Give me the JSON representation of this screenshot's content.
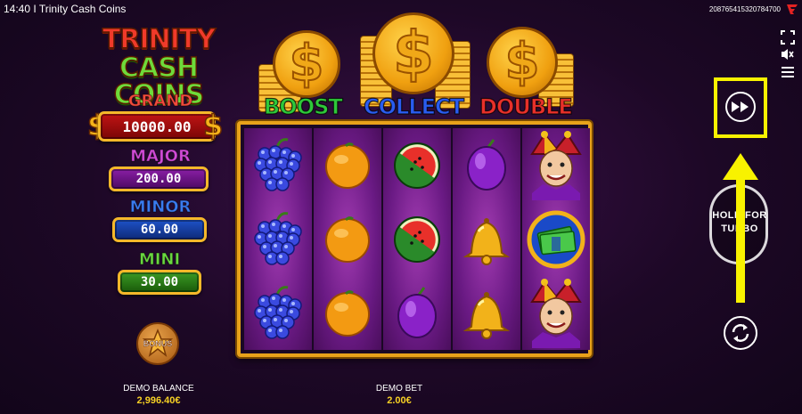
{
  "top_bar": {
    "time": "14:40",
    "separator": "I",
    "game_title": "Trinity Cash Coins",
    "session_id": "208765415320784700"
  },
  "logo": {
    "line1": "TRINITY",
    "line2": "CASH COINS"
  },
  "jackpots": {
    "grand": {
      "label": "GRAND",
      "value": "10000.00",
      "color": "#c01414"
    },
    "major": {
      "label": "MAJOR",
      "value": "200.00",
      "color": "#8a1ea6"
    },
    "minor": {
      "label": "MINOR",
      "value": "60.00",
      "color": "#1e52c8"
    },
    "mini": {
      "label": "MINI",
      "value": "30.00",
      "color": "#3a9a24"
    }
  },
  "bonus": {
    "label": "BONUS"
  },
  "features": {
    "boost": {
      "label": "BOOST",
      "color": "#2ec83a"
    },
    "collect": {
      "label": "COLLECT",
      "color": "#2a5cf0"
    },
    "double": {
      "label": "DOUBLE",
      "color": "#e8302a"
    }
  },
  "reels": [
    [
      "grapes",
      "grapes",
      "grapes"
    ],
    [
      "orange",
      "orange",
      "orange"
    ],
    [
      "watermelon",
      "watermelon",
      "plum"
    ],
    [
      "plum",
      "bell",
      "bell"
    ],
    [
      "joker",
      "cash-coin",
      "joker"
    ]
  ],
  "controls": {
    "hold_line1": "HOLD FOR",
    "hold_line2": "TURBO",
    "highlight_color": "#f8f200"
  },
  "footer": {
    "balance_label": "DEMO BALANCE",
    "balance_value": "2,996.40€",
    "bet_label": "DEMO BET",
    "bet_value": "2.00€"
  }
}
